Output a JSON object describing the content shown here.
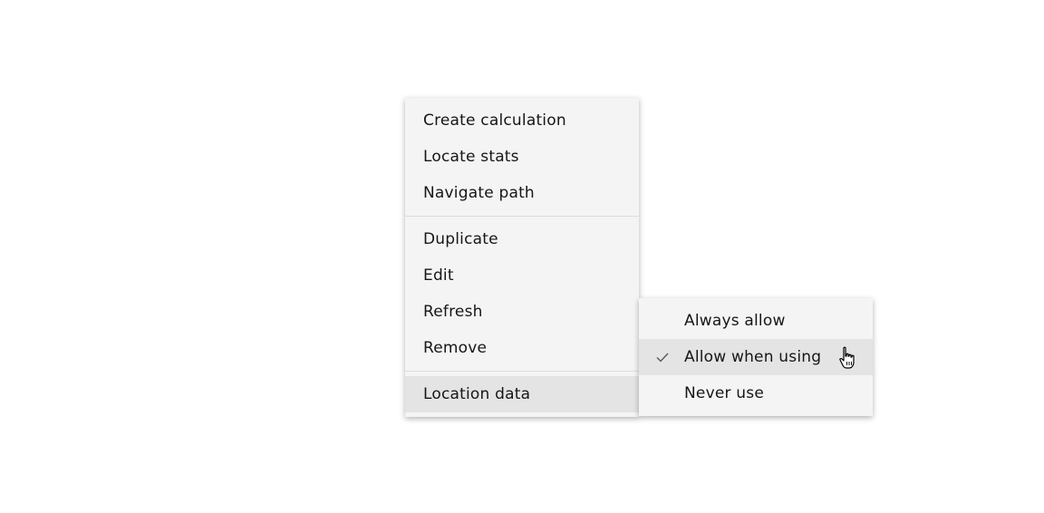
{
  "context_menu": {
    "groups": [
      [
        {
          "label": "Create calculation"
        },
        {
          "label": "Locate stats"
        },
        {
          "label": "Navigate path"
        }
      ],
      [
        {
          "label": "Duplicate"
        },
        {
          "label": "Edit"
        },
        {
          "label": "Refresh"
        },
        {
          "label": "Remove"
        }
      ],
      [
        {
          "label": "Location data",
          "active": true,
          "has_submenu": true
        }
      ]
    ]
  },
  "submenu": {
    "items": [
      {
        "label": "Always allow",
        "selected": false
      },
      {
        "label": "Allow when using",
        "selected": true,
        "hovered": true
      },
      {
        "label": "Never use",
        "selected": false
      }
    ],
    "check_icon": "checkmark-icon"
  },
  "cursor": {
    "icon": "hand-pointer-icon"
  },
  "colors": {
    "menu_bg": "#f4f4f4",
    "active_bg": "#e4e4e4",
    "divider": "#dcdcdc",
    "text": "#161616"
  }
}
